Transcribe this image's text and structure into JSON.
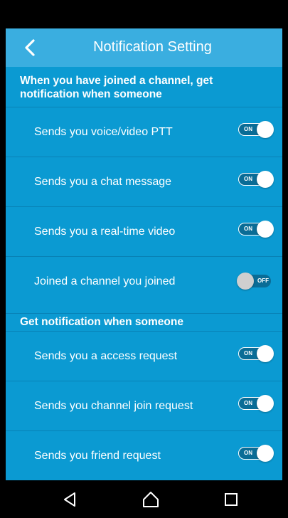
{
  "header": {
    "title": "Notification Setting",
    "back_icon": "chevron-left-icon"
  },
  "sections": [
    {
      "title": "When you have joined a channel, get notification when someone",
      "items": [
        {
          "label": "Sends you voice/video PTT",
          "state": "ON",
          "enabled": true
        },
        {
          "label": "Sends you a chat message",
          "state": "ON",
          "enabled": true
        },
        {
          "label": "Sends you a real-time video",
          "state": "ON",
          "enabled": true
        },
        {
          "label": "Joined a channel you joined",
          "state": "OFF",
          "enabled": false
        }
      ]
    },
    {
      "title": "Get notification when someone",
      "items": [
        {
          "label": "Sends you a access request",
          "state": "ON",
          "enabled": true
        },
        {
          "label": "Sends you channel join request",
          "state": "ON",
          "enabled": true
        },
        {
          "label": "Sends you friend request",
          "state": "ON",
          "enabled": true
        }
      ]
    }
  ],
  "nav": {
    "back_icon": "triangle-back-icon",
    "home_icon": "home-icon",
    "recents_icon": "square-recents-icon"
  },
  "colors": {
    "background": "#0b9ad2",
    "app_bar": "#3aaee0",
    "toggle_track": "#0a6c96"
  }
}
